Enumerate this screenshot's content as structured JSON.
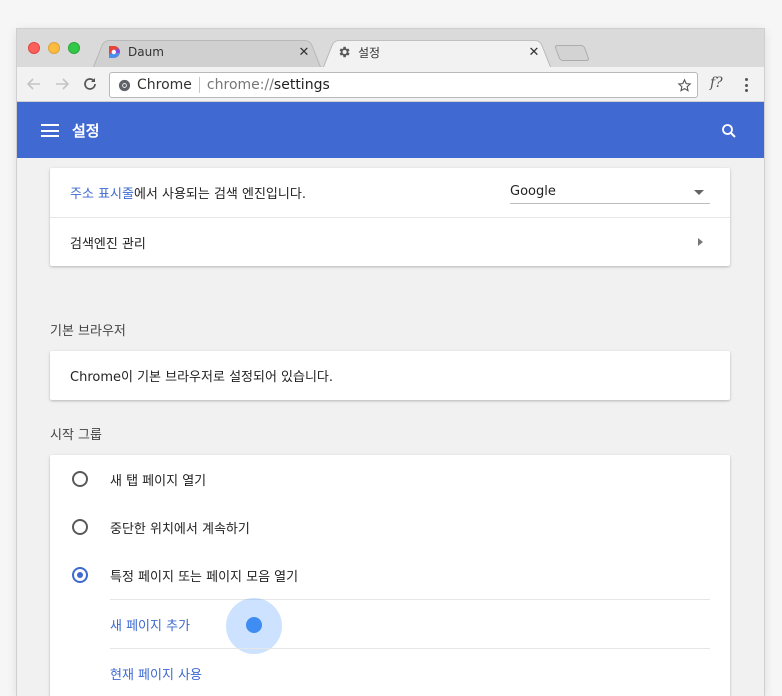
{
  "tabs": [
    {
      "title": "Daum",
      "active": false
    },
    {
      "title": "설정",
      "active": true
    }
  ],
  "omnibox": {
    "chip": "Chrome",
    "url_prefix": "chrome://",
    "url_path": "settings"
  },
  "toolbar": {
    "extension_label": "f?"
  },
  "header": {
    "title": "설정"
  },
  "search_engine": {
    "link_text": "주소 표시줄",
    "description_rest": "에서 사용되는 검색 엔진입니다.",
    "selected": "Google",
    "manage_label": "검색엔진 관리"
  },
  "default_browser": {
    "section_title": "기본 브라우저",
    "status": "Chrome이 기본 브라우저로 설정되어 있습니다."
  },
  "startup": {
    "section_title": "시작 그룹",
    "options": [
      {
        "label": "새 탭 페이지 열기",
        "checked": false
      },
      {
        "label": "중단한 위치에서 계속하기",
        "checked": false
      },
      {
        "label": "특정 페이지 또는 페이지 모음 열기",
        "checked": true
      }
    ],
    "add_page": "새 페이지 추가",
    "use_current": "현재 페이지 사용"
  },
  "colors": {
    "accent": "#4169d2",
    "link": "#3d69d0"
  }
}
